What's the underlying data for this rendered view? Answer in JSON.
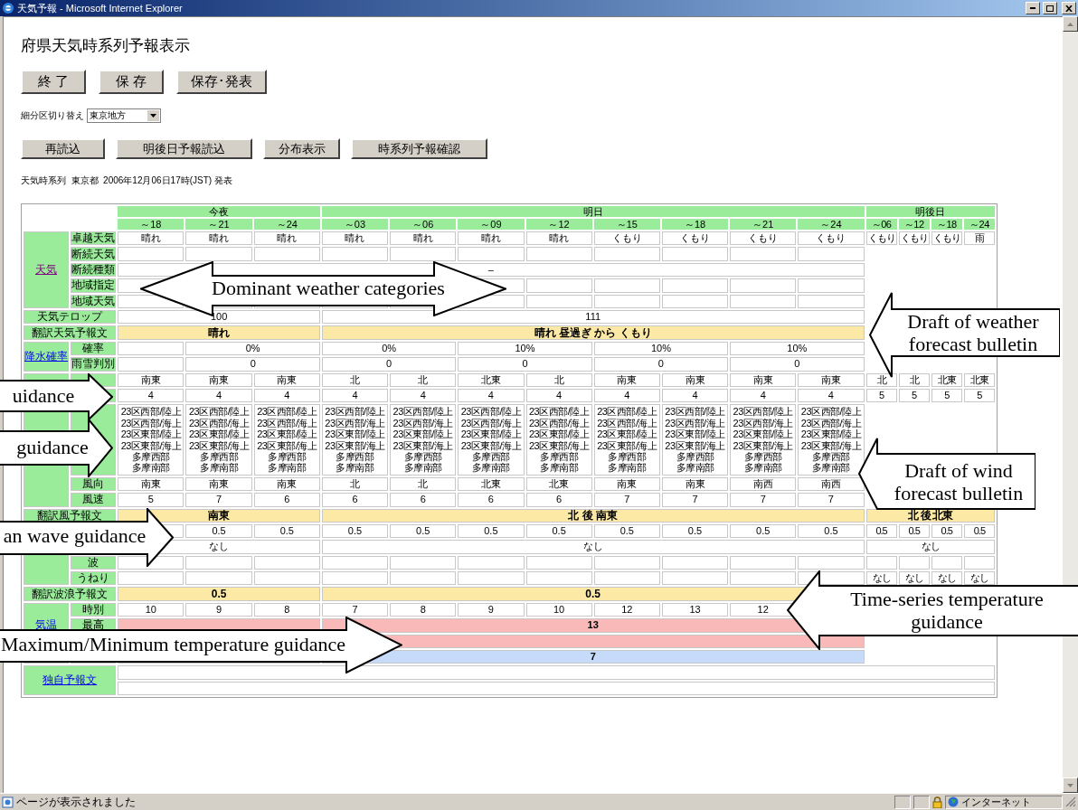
{
  "window": {
    "title": "天気予報 - Microsoft Internet Explorer"
  },
  "page_title": "府県天気時系列予報表示",
  "main_buttons": [
    "終 了",
    "保 存",
    "保存･発表"
  ],
  "subdivision": {
    "label": "細分区切り替え",
    "value": "東京地方"
  },
  "action_buttons": [
    "再読込",
    "明後日予報読込",
    "分布表示",
    "時系列予報確認"
  ],
  "issued": "天気時系列  東京都  2006年12月06日17時(JST) 発表",
  "table": {
    "periods": [
      {
        "label": "今夜",
        "kind": "main",
        "times": [
          "～18",
          "～21",
          "～24"
        ]
      },
      {
        "label": "明日",
        "kind": "main",
        "times": [
          "～03",
          "～06",
          "～09",
          "～12",
          "～15",
          "～18",
          "～21",
          "～24"
        ]
      },
      {
        "label": "明後日",
        "kind": "extended",
        "times": [
          "～06",
          "～12",
          "～18",
          "～24"
        ]
      }
    ],
    "sections": [
      {
        "kind": "group",
        "link": {
          "text": "天気",
          "visited": true
        },
        "rows": [
          {
            "label": "卓越天気",
            "kind": "hourly",
            "cells": [
              "晴れ",
              "晴れ",
              "晴れ",
              "晴れ",
              "晴れ",
              "晴れ",
              "晴れ",
              "くもり",
              "くもり",
              "くもり",
              "くもり"
            ],
            "extra": [
              "くもり",
              "くもり",
              "くもり",
              "雨"
            ]
          },
          {
            "label": "断続天気",
            "kind": "blank"
          },
          {
            "label": "断続種類",
            "kind": "span",
            "cells": [
              "–"
            ]
          },
          {
            "label": "地域指定",
            "kind": "blank"
          },
          {
            "label": "地域天気",
            "kind": "blank"
          }
        ]
      },
      {
        "kind": "wide",
        "label": "天気テロップ",
        "rows": [
          {
            "kind": "period",
            "cells": [
              "100",
              "111"
            ]
          }
        ]
      },
      {
        "kind": "wide",
        "label": "翻訳天気予報文",
        "rows": [
          {
            "kind": "bulletin",
            "cells": [
              "晴れ",
              "晴れ 昼過ぎ から くもり"
            ]
          }
        ]
      },
      {
        "kind": "group",
        "link": {
          "text": "降水確率",
          "visited": false
        },
        "rows": [
          {
            "label": "確率",
            "kind": "pairs",
            "cells": [
              null,
              "0%",
              "0%",
              "10%",
              "10%",
              "10%"
            ]
          },
          {
            "label": "雨雪判別",
            "kind": "pairs",
            "cells": [
              null,
              "0",
              "0",
              "0",
              "0",
              "0"
            ]
          }
        ]
      },
      {
        "kind": "group",
        "rows": [
          {
            "kind": "hourly",
            "cells": [
              "南東",
              "南東",
              "南東",
              "北",
              "北",
              "北東",
              "北",
              "南東",
              "南東",
              "南東",
              "南東"
            ],
            "extra": [
              "北",
              "北",
              "北東",
              "北東"
            ]
          },
          {
            "kind": "hourly",
            "cells": [
              "4",
              "4",
              "4",
              "4",
              "4",
              "4",
              "4",
              "4",
              "4",
              "4",
              "4"
            ],
            "extra": [
              "5",
              "5",
              "5",
              "5"
            ]
          },
          {
            "kind": "lines",
            "cells": [
              [
                "23区西部/陸上",
                "23区西部/海上",
                "23区東部/陸上",
                "23区東部/海上",
                "多摩西部",
                "多摩南部"
              ],
              [
                "23区西部/陸上",
                "23区西部/海上",
                "23区東部/陸上",
                "23区東部/海上",
                "多摩西部",
                "多摩南部"
              ],
              [
                "23区西部/陸上",
                "23区西部/海上",
                "23区東部/陸上",
                "23区東部/海上",
                "多摩西部",
                "多摩南部"
              ],
              [
                "23区西部/陸上",
                "23区西部/海上",
                "23区東部/陸上",
                "23区東部/海上",
                "多摩西部",
                "多摩南部"
              ],
              [
                "23区西部/陸上",
                "23区西部/海上",
                "23区東部/陸上",
                "23区東部/海上",
                "多摩西部",
                "多摩南部"
              ],
              [
                "23区西部/陸上",
                "23区西部/海上",
                "23区東部/陸上",
                "23区東部/海上",
                "多摩西部",
                "多摩南部"
              ],
              [
                "23区西部/陸上",
                "23区西部/海上",
                "23区東部/陸上",
                "23区東部/海上",
                "多摩西部",
                "多摩南部"
              ],
              [
                "23区西部/陸上",
                "23区西部/海上",
                "23区東部/陸上",
                "23区東部/海上",
                "多摩西部",
                "多摩南部"
              ],
              [
                "23区西部/陸上",
                "23区西部/海上",
                "23区東部/陸上",
                "23区東部/海上",
                "多摩西部",
                "多摩南部"
              ],
              [
                "23区西部/陸上",
                "23区西部/海上",
                "23区東部/陸上",
                "23区東部/海上",
                "多摩西部",
                "多摩南部"
              ],
              [
                "23区西部/陸上",
                "23区西部/海上",
                "23区東部/陸上",
                "23区東部/海上",
                "多摩西部",
                "多摩南部"
              ]
            ]
          },
          {
            "label": "風向",
            "kind": "hourly",
            "cells": [
              "南東",
              "南東",
              "南東",
              "北",
              "北",
              "北東",
              "北東",
              "南東",
              "南東",
              "南西",
              "南西"
            ]
          },
          {
            "label": "風速",
            "kind": "hourly",
            "cells": [
              "5",
              "7",
              "6",
              "6",
              "6",
              "6",
              "6",
              "7",
              "7",
              "7",
              "7"
            ]
          }
        ]
      },
      {
        "kind": "wide",
        "label": "翻訳風予報文",
        "rows": [
          {
            "kind": "bulletin",
            "cells": [
              "南東",
              "北 後 南東",
              "北 後 北東"
            ]
          }
        ]
      },
      {
        "kind": "group",
        "rows": [
          {
            "kind": "hourly",
            "cells": [
              null,
              "0.5",
              "0.5",
              "0.5",
              "0.5",
              "0.5",
              "0.5",
              "0.5",
              "0.5",
              "0.5",
              "0.5"
            ],
            "extra": [
              "0.5",
              "0.5",
              "0.5",
              "0.5"
            ]
          },
          {
            "kind": "period",
            "cells": [
              "なし",
              "なし",
              "なし"
            ]
          },
          {
            "label": "波",
            "kind": "blank_extended"
          },
          {
            "label": "うねり",
            "kind": "hourly",
            "cells": [
              null,
              null,
              null,
              null,
              null,
              null,
              null,
              null,
              null,
              null,
              null
            ],
            "extra": [
              "なし",
              "なし",
              "なし",
              "なし"
            ]
          }
        ]
      },
      {
        "kind": "wide",
        "label": "翻訳波浪予報文",
        "rows": [
          {
            "kind": "bulletin",
            "cells": [
              "0.5",
              "0.5"
            ]
          }
        ]
      },
      {
        "kind": "group",
        "link": {
          "text": "気温",
          "visited": false
        },
        "rows": [
          {
            "label": "時別",
            "kind": "hourly",
            "cells": [
              "10",
              "9",
              "8",
              "7",
              "8",
              "9",
              "10",
              "12",
              "13",
              "12",
              null
            ]
          },
          {
            "label": "最高",
            "kind": "maximum",
            "values": {
              "tomorrow": "13"
            }
          },
          {
            "kind": "maximum"
          }
        ]
      },
      {
        "kind": "group",
        "rows": [
          {
            "kind": "minimum",
            "values": {
              "tomorrow": "7"
            }
          }
        ]
      },
      {
        "kind": "wide",
        "link": {
          "text": "独自予報文",
          "visited": false
        },
        "rows": [
          {
            "kind": "blank_full"
          },
          {
            "kind": "blank_full"
          }
        ]
      }
    ]
  },
  "callouts": [
    {
      "kind": "double",
      "text": "Dominant weather categories"
    },
    {
      "kind": "left",
      "text": "Draft of weather forecast bulletin"
    },
    {
      "kind": "right",
      "text": "uidance"
    },
    {
      "kind": "right",
      "text": "guidance"
    },
    {
      "kind": "left",
      "text": "Draft of wind forecast bulletin"
    },
    {
      "kind": "right",
      "text": "an wave guidance"
    },
    {
      "kind": "left",
      "text": "Time-series temperature guidance"
    },
    {
      "kind": "right",
      "text": "Maximum/Minimum temperature guidance"
    }
  ],
  "status": {
    "text": "ページが表示されました",
    "zone": "インターネット"
  }
}
